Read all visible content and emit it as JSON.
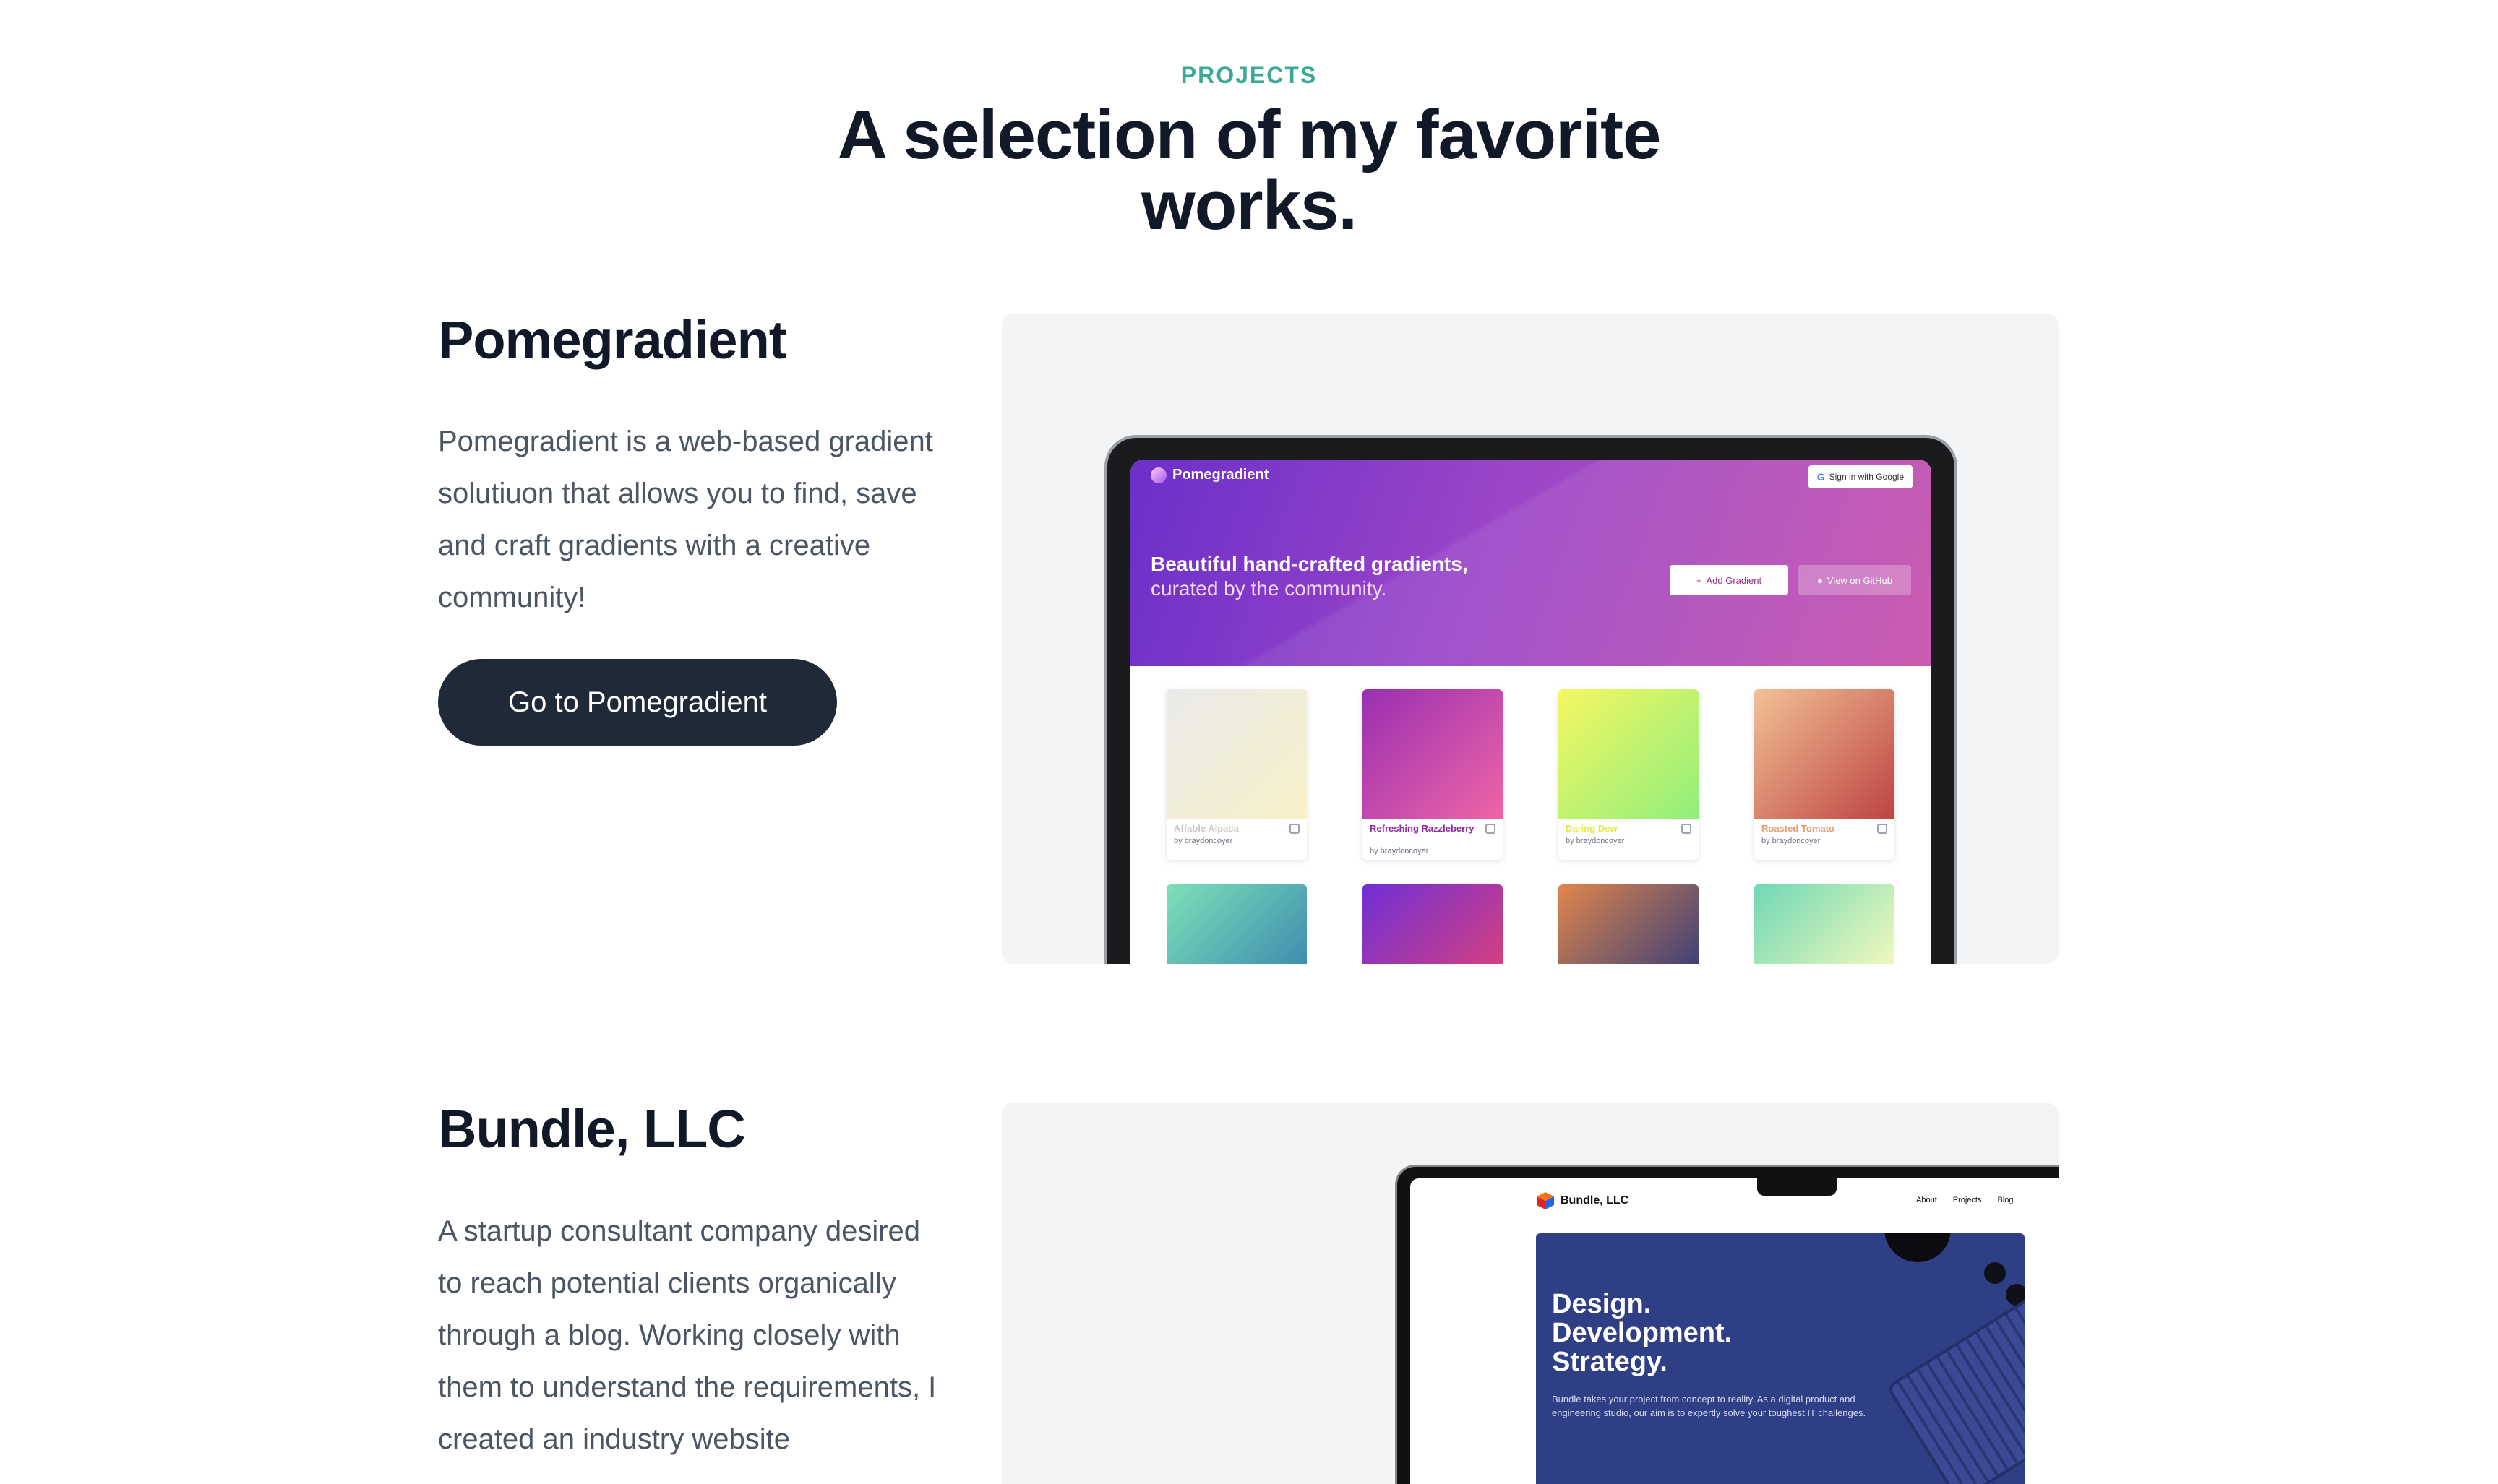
{
  "section": {
    "eyebrow": "PROJECTS",
    "headline": "A selection of my favorite works."
  },
  "projects": [
    {
      "title": "Pomegradient",
      "description": "Pomegradient is a web-based gradient solutiuon that allows you to find, save and craft gradients with a creative community!",
      "cta": "Go to Pomegradient",
      "screenshot": {
        "brand": "Pomegradient",
        "sign_in": "Sign in with Google",
        "hero_title": "Beautiful hand-crafted gradients,",
        "hero_subtitle": "curated by the community.",
        "add_button": "Add Gradient",
        "github_button": "View on GitHub",
        "cards": [
          {
            "name": "Affable Alpaca",
            "author": "by braydoncoyer",
            "color": "#c9c9c9",
            "from": "#eaeaea",
            "to": "#f8f1c8"
          },
          {
            "name": "Refreshing Razzleberry",
            "author": "by braydoncoyer",
            "color": "#8e2b9e",
            "from": "#9a2fb2",
            "to": "#ee65a6"
          },
          {
            "name": "Daring Dew",
            "author": "by braydoncoyer",
            "color": "#e8e84a",
            "from": "#f5f762",
            "to": "#90ee7c"
          },
          {
            "name": "Roasted Tomato",
            "author": "by braydoncoyer",
            "color": "#e59a72",
            "from": "#f2c196",
            "to": "#bd4440"
          }
        ],
        "row2": [
          {
            "from": "#7ee0b7",
            "to": "#3c8bb0"
          },
          {
            "from": "#6f2fd6",
            "to": "#d6407f"
          },
          {
            "from": "#e0864c",
            "to": "#3b3f78"
          },
          {
            "from": "#6fd8b4",
            "to": "#f5fabc"
          }
        ]
      }
    },
    {
      "title": "Bundle, LLC",
      "description": "A startup consultant company desired to reach potential clients organically through a blog. Working closely with them to understand the requirements, I created an industry website",
      "screenshot": {
        "brand": "Bundle, LLC",
        "nav": [
          "About",
          "Projects",
          "Blog"
        ],
        "hero_title": "Design.\nDevelopment.\nStrategy.",
        "hero_text": "Bundle takes your project from concept to reality. As a digital product and engineering studio, our aim is to expertly solve your toughest IT challenges."
      }
    }
  ],
  "colors": {
    "accent": "#3aa996",
    "heading": "#111827",
    "body_text": "#4b5563",
    "button_bg": "#1f2937",
    "panel_bg": "#f3f4f6"
  }
}
